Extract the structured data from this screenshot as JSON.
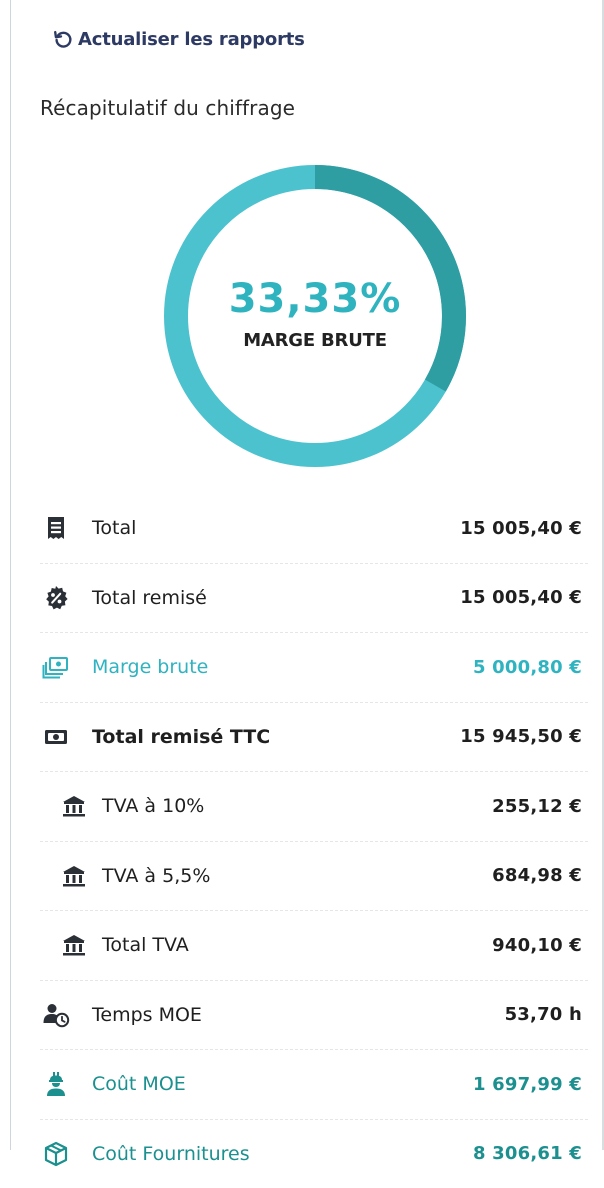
{
  "refresh": {
    "label": "Actualiser les rapports",
    "icon": "refresh-icon"
  },
  "summary": {
    "title": "Récapitulatif du chiffrage"
  },
  "donut": {
    "percent_text": "33,33%",
    "percent_value": 33.33,
    "label": "MARGE BRUTE",
    "colors": {
      "margin": "#2e9ea3",
      "rest": "#4cc2cf"
    }
  },
  "rows": [
    {
      "label": "Total",
      "value": "15 005,40 €",
      "icon": "receipt-icon"
    },
    {
      "label": "Total remisé",
      "value": "15 005,40 €",
      "icon": "discount-badge-icon"
    },
    {
      "label": "Marge brute",
      "value": "5 000,80 €",
      "icon": "money-stack-icon",
      "color": "#30b3c0"
    },
    {
      "label": "Total remisé TTC",
      "value": "15 945,50 €",
      "icon": "banknote-icon"
    },
    {
      "label": "TVA à 10%",
      "value": "255,12 €",
      "icon": "bank-icon"
    },
    {
      "label": "TVA à 5,5%",
      "value": "684,98 €",
      "icon": "bank-icon"
    },
    {
      "label": "Total TVA",
      "value": "940,10 €",
      "icon": "bank-icon"
    },
    {
      "label": "Temps MOE",
      "value": "53,70 h",
      "icon": "user-clock-icon"
    },
    {
      "label": "Coût MOE",
      "value": "1 697,99 €",
      "icon": "worker-icon",
      "color": "#1c8f8f"
    },
    {
      "label": "Coût Fournitures",
      "value": "8 306,61 €",
      "icon": "box-icon",
      "color": "#1c8f8f"
    }
  ]
}
